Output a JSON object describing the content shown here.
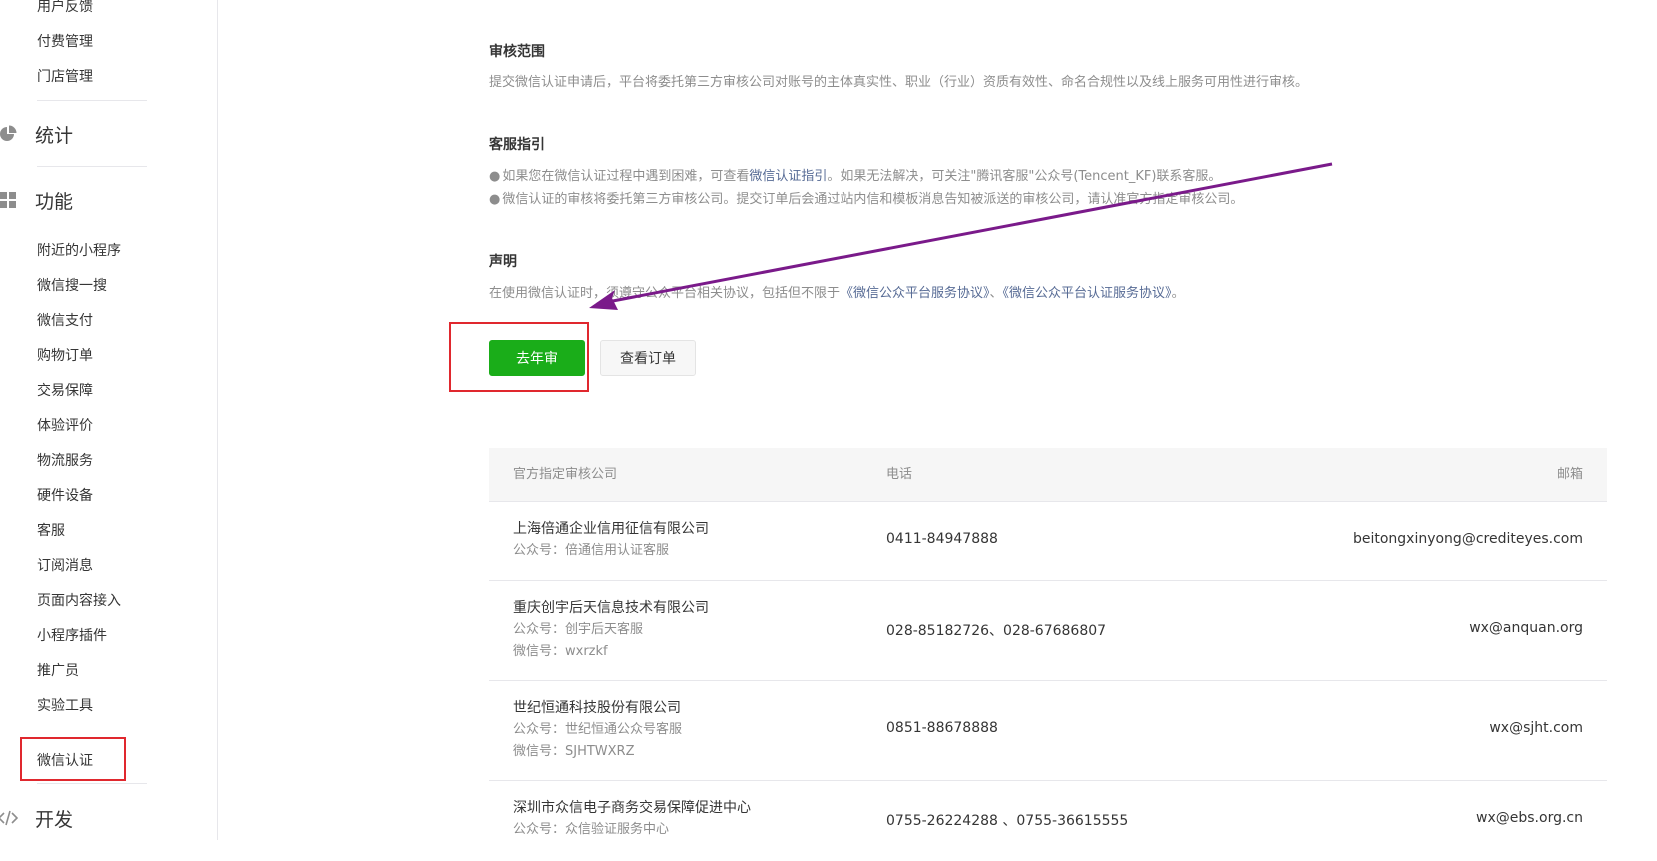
{
  "sidebar": {
    "top_items": [
      "用户反馈",
      "付费管理",
      "门店管理"
    ],
    "sections": {
      "stats": "统计",
      "features": "功能",
      "develop": "开发"
    },
    "feature_items": [
      "附近的小程序",
      "微信搜一搜",
      "微信支付",
      "购物订单",
      "交易保障",
      "体验评价",
      "物流服务",
      "硬件设备",
      "客服",
      "订阅消息",
      "页面内容接入",
      "小程序插件",
      "推广员",
      "实验工具",
      "微信认证"
    ],
    "active_item": "微信认证",
    "icons": {
      "stats": "pie-chart-icon",
      "features": "grid-icon",
      "develop": "code-icon"
    }
  },
  "review_scope": {
    "title": "审核范围",
    "text": "提交微信认证申请后，平台将委托第三方审核公司对账号的主体真实性、职业（行业）资质有效性、命名合规性以及线上服务可用性进行审核。"
  },
  "customer_service": {
    "title": "客服指引",
    "line1_pre": "如果您在微信认证过程中遇到困难，可查看",
    "line1_link": "微信认证指引",
    "line1_post": "。如果无法解决，可关注\"腾讯客服\"公众号(Tencent_KF)联系客服。",
    "line2": "微信认证的审核将委托第三方审核公司。提交订单后会通过站内信和模板消息告知被派送的审核公司，请认准官方指定审核公司。"
  },
  "statement": {
    "title": "声明",
    "text_pre": "在使用微信认证时，须遵守公众平台相关协议，包括但不限于",
    "link1": "《微信公众平台服务协议》",
    "sep": "、",
    "link2": "《微信公众平台认证服务协议》",
    "text_post": "。"
  },
  "buttons": {
    "primary": "去年审",
    "secondary": "查看订单"
  },
  "table": {
    "headers": [
      "官方指定审核公司",
      "电话",
      "邮箱"
    ],
    "rows": [
      {
        "company": "上海倍通企业信用征信有限公司",
        "lines": [
          "公众号：倍通信用认证客服"
        ],
        "phone": "0411-84947888",
        "email": "beitongxinyong@crediteyes.com"
      },
      {
        "company": "重庆创宇后天信息技术有限公司",
        "lines": [
          "公众号：创宇后天客服",
          "微信号：wxrzkf"
        ],
        "phone": "028-85182726、028-67686807",
        "email": "wx@anquan.org"
      },
      {
        "company": "世纪恒通科技股份有限公司",
        "lines": [
          "公众号：世纪恒通公众号客服",
          "微信号：SJHTWXRZ"
        ],
        "phone": "0851-88678888",
        "email": "wx@sjht.com"
      },
      {
        "company": "深圳市众信电子商务交易保障促进中心",
        "lines": [
          "公众号：众信验证服务中心"
        ],
        "phone": "0755-26224288 、0755-36615555",
        "email": "wx@ebs.org.cn"
      }
    ]
  },
  "colors": {
    "accent_green": "#1aad19",
    "highlight_red": "#e0282e",
    "arrow_purple": "#7a1a8a",
    "link_blue": "#576b95"
  }
}
